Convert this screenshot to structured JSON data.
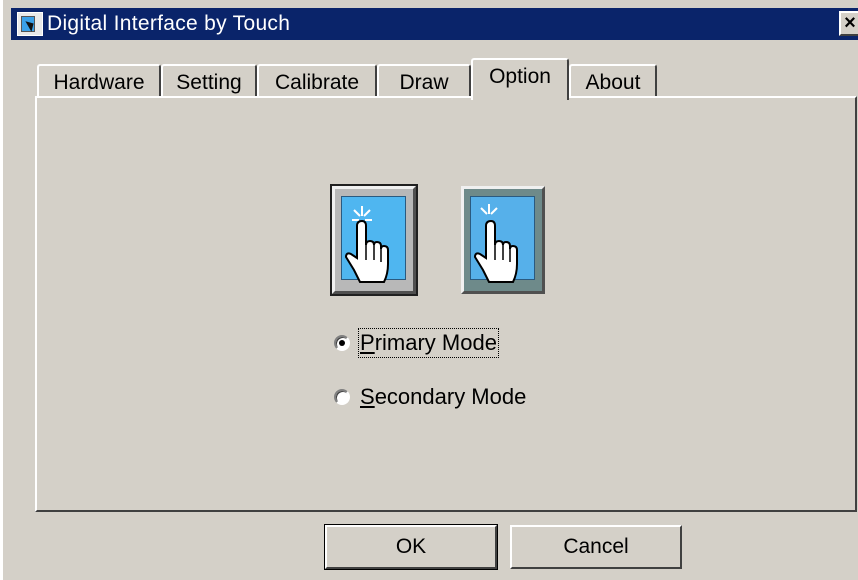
{
  "window": {
    "title": "Digital Interface by Touch",
    "close_label": "×"
  },
  "tabs": [
    {
      "label": "Hardware"
    },
    {
      "label": "Setting"
    },
    {
      "label": "Calibrate"
    },
    {
      "label": "Draw"
    },
    {
      "label": "Option",
      "active": true
    },
    {
      "label": "About"
    }
  ],
  "option_panel": {
    "images": [
      {
        "icon": "touch-hand-primary-icon"
      },
      {
        "icon": "touch-hand-secondary-icon"
      }
    ],
    "modes": [
      {
        "underline": "P",
        "rest": "rimary Mode",
        "selected": true
      },
      {
        "underline": "S",
        "rest": "econdary Mode",
        "selected": false
      }
    ]
  },
  "buttons": {
    "ok_label": "OK",
    "cancel_label": "Cancel"
  },
  "colors": {
    "title_bar": "#0a246a",
    "face": "#d4d0c8",
    "screen_blue": "#4fb6f0"
  }
}
